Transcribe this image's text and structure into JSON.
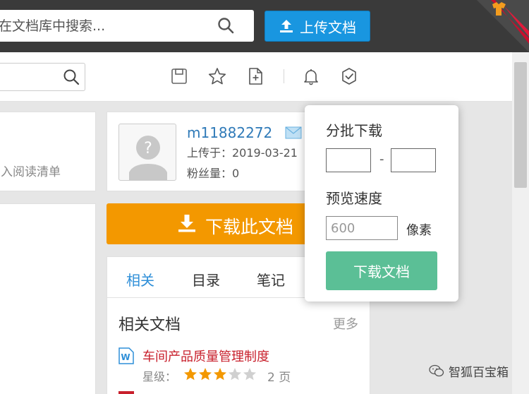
{
  "header": {
    "search_placeholder": "在文档库中搜索...",
    "upload_label": "上传文档"
  },
  "toolbar": {
    "icons": [
      "save-icon",
      "star-icon",
      "add-file-icon",
      "bell-icon",
      "shield-check-icon"
    ]
  },
  "left_panel": {
    "add_reading_list": "入阅读清单"
  },
  "uploader": {
    "name": "m11882272",
    "upload_date": "上传于：2019-03-21",
    "fans": "粉丝量：0"
  },
  "download": {
    "label": "下载此文档"
  },
  "tabs": [
    {
      "label": "相关",
      "active": true
    },
    {
      "label": "目录",
      "active": false
    },
    {
      "label": "笔记",
      "active": false
    }
  ],
  "related": {
    "title": "相关文档",
    "more": "更多",
    "items": [
      {
        "title": "车间产品质量管理制度",
        "rating_label": "星级：",
        "rating": 3,
        "max_rating": 5,
        "pages": "2 页"
      }
    ]
  },
  "batch_popover": {
    "title": "分批下载",
    "range_dash": "-",
    "from_value": "",
    "to_value": "",
    "speed_title": "预览速度",
    "speed_placeholder": "600",
    "speed_unit": "像素",
    "button_label": "下载文档"
  },
  "watermark": {
    "text": "智狐百宝箱"
  },
  "colors": {
    "header_bg": "#3a3a3a",
    "upload_blue": "#1996e0",
    "download_orange": "#f39800",
    "popover_green": "#5bbf96",
    "link_blue": "#2f8fd8",
    "doc_red": "#c8202c",
    "star_orange": "#f39800",
    "star_empty": "#d0d0d0"
  }
}
